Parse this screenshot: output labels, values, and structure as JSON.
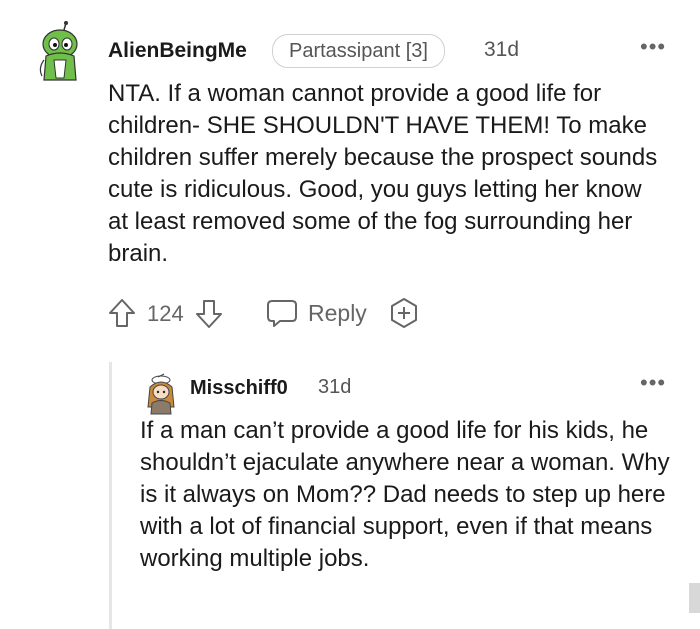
{
  "comment": {
    "username": "AlienBeingMe",
    "flair": "Partassipant [3]",
    "age": "31d",
    "more": "•••",
    "text": "NTA. If a woman cannot provide a good life for children- SHE SHOULDN'T HAVE THEM! To make children suffer merely because the prospect sounds cute is ridiculous. Good, you guys letting her know at least removed some of the fog surrounding her brain.",
    "score": "124",
    "reply_label": "Reply"
  },
  "reply": {
    "username": "Misschiff0",
    "age": "31d",
    "more": "•••",
    "text": "If a man can’t provide a good life for his kids, he shouldn’t ejaculate anywhere near a woman. Why is it always on Mom?? Dad needs to step up here with a lot of financial support, even if that means working multiple jobs."
  },
  "colors": {
    "avatar_green": "#6fbf4a",
    "text": "#1a1a1b",
    "muted": "#666666",
    "thread_line": "#e6e6e6"
  }
}
